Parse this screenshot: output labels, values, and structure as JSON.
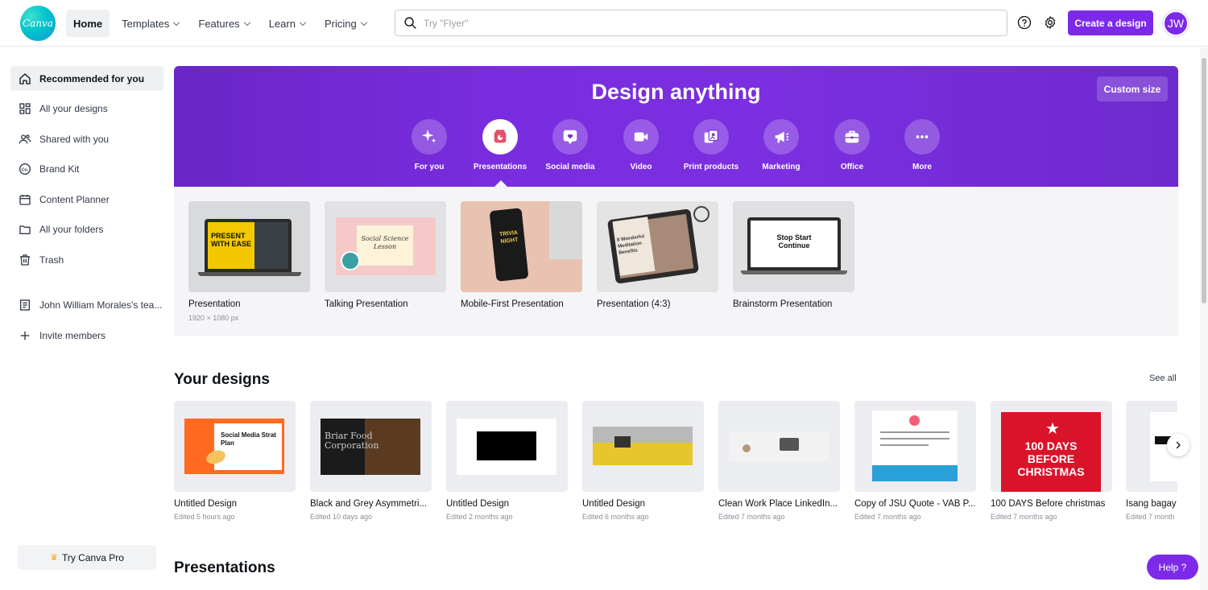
{
  "header": {
    "logo_text": "Canva",
    "nav": [
      {
        "label": "Home",
        "active": true,
        "has_menu": false
      },
      {
        "label": "Templates",
        "has_menu": true
      },
      {
        "label": "Features",
        "has_menu": true
      },
      {
        "label": "Learn",
        "has_menu": true
      },
      {
        "label": "Pricing",
        "has_menu": true
      }
    ],
    "search_placeholder": "Try \"Flyer\"",
    "create_label": "Create a design",
    "avatar_initials": "JW"
  },
  "sidebar": {
    "items": [
      {
        "label": "Recommended for you",
        "icon": "home-icon",
        "active": true
      },
      {
        "label": "All your designs",
        "icon": "grid-icon"
      },
      {
        "label": "Shared with you",
        "icon": "people-icon"
      },
      {
        "label": "Brand Kit",
        "icon": "brand-kit-icon"
      },
      {
        "label": "Content Planner",
        "icon": "calendar-icon"
      },
      {
        "label": "All your folders",
        "icon": "folder-icon"
      },
      {
        "label": "Trash",
        "icon": "trash-icon"
      },
      {
        "label": "John William Morales's tea...",
        "icon": "team-icon"
      },
      {
        "label": "Invite members",
        "icon": "plus-icon"
      }
    ],
    "try_pro": "Try Canva Pro"
  },
  "hero": {
    "title": "Design anything",
    "custom_size": "Custom size",
    "categories": [
      {
        "label": "For you",
        "icon": "sparkle-icon"
      },
      {
        "label": "Presentations",
        "icon": "presentation-icon",
        "active": true
      },
      {
        "label": "Social media",
        "icon": "heart-icon"
      },
      {
        "label": "Video",
        "icon": "video-icon"
      },
      {
        "label": "Print products",
        "icon": "print-icon"
      },
      {
        "label": "Marketing",
        "icon": "megaphone-icon"
      },
      {
        "label": "Office",
        "icon": "briefcase-icon"
      },
      {
        "label": "More",
        "icon": "more-icon"
      }
    ]
  },
  "templates": [
    {
      "label": "Presentation",
      "sub": "1920 × 1080 px",
      "thumb_text": "PRESENT WITH EASE"
    },
    {
      "label": "Talking Presentation",
      "thumb_text": "Social Science Lesson"
    },
    {
      "label": "Mobile-First Presentation",
      "thumb_text": "TRIVIA NIGHT"
    },
    {
      "label": "Presentation (4:3)",
      "thumb_text": "8 Wonderful Meditation Benefits"
    },
    {
      "label": "Brainstorm Presentation",
      "thumb_text": "Stop Start Continue"
    }
  ],
  "your_designs": {
    "title": "Your designs",
    "see_all": "See all",
    "items": [
      {
        "label": "Untitled Design",
        "edited": "Edited 5 hours ago",
        "thumb_text": "Social Media Strat Plan"
      },
      {
        "label": "Black and Grey Asymmetri...",
        "edited": "Edited 10 days ago",
        "thumb_text": "Briar Food Corporation"
      },
      {
        "label": "Untitled Design",
        "edited": "Edited 2 months ago"
      },
      {
        "label": "Untitled Design",
        "edited": "Edited 6 months ago"
      },
      {
        "label": "Clean Work Place LinkedIn...",
        "edited": "Edited 7 months ago"
      },
      {
        "label": "Copy of JSU Quote - VAB P...",
        "edited": "Edited 7 months ago"
      },
      {
        "label": "100 DAYS Before christmas",
        "edited": "Edited 7 months ago",
        "thumb_text": "100 DAYS BEFORE CHRISTMAS"
      },
      {
        "label": "Isang bagay",
        "edited": "Edited 7 month"
      }
    ]
  },
  "presentations": {
    "title": "Presentations"
  },
  "help_label": "Help ?",
  "colors": {
    "accent": "#7d2ae8",
    "canva_teal": "#00c4cc"
  }
}
